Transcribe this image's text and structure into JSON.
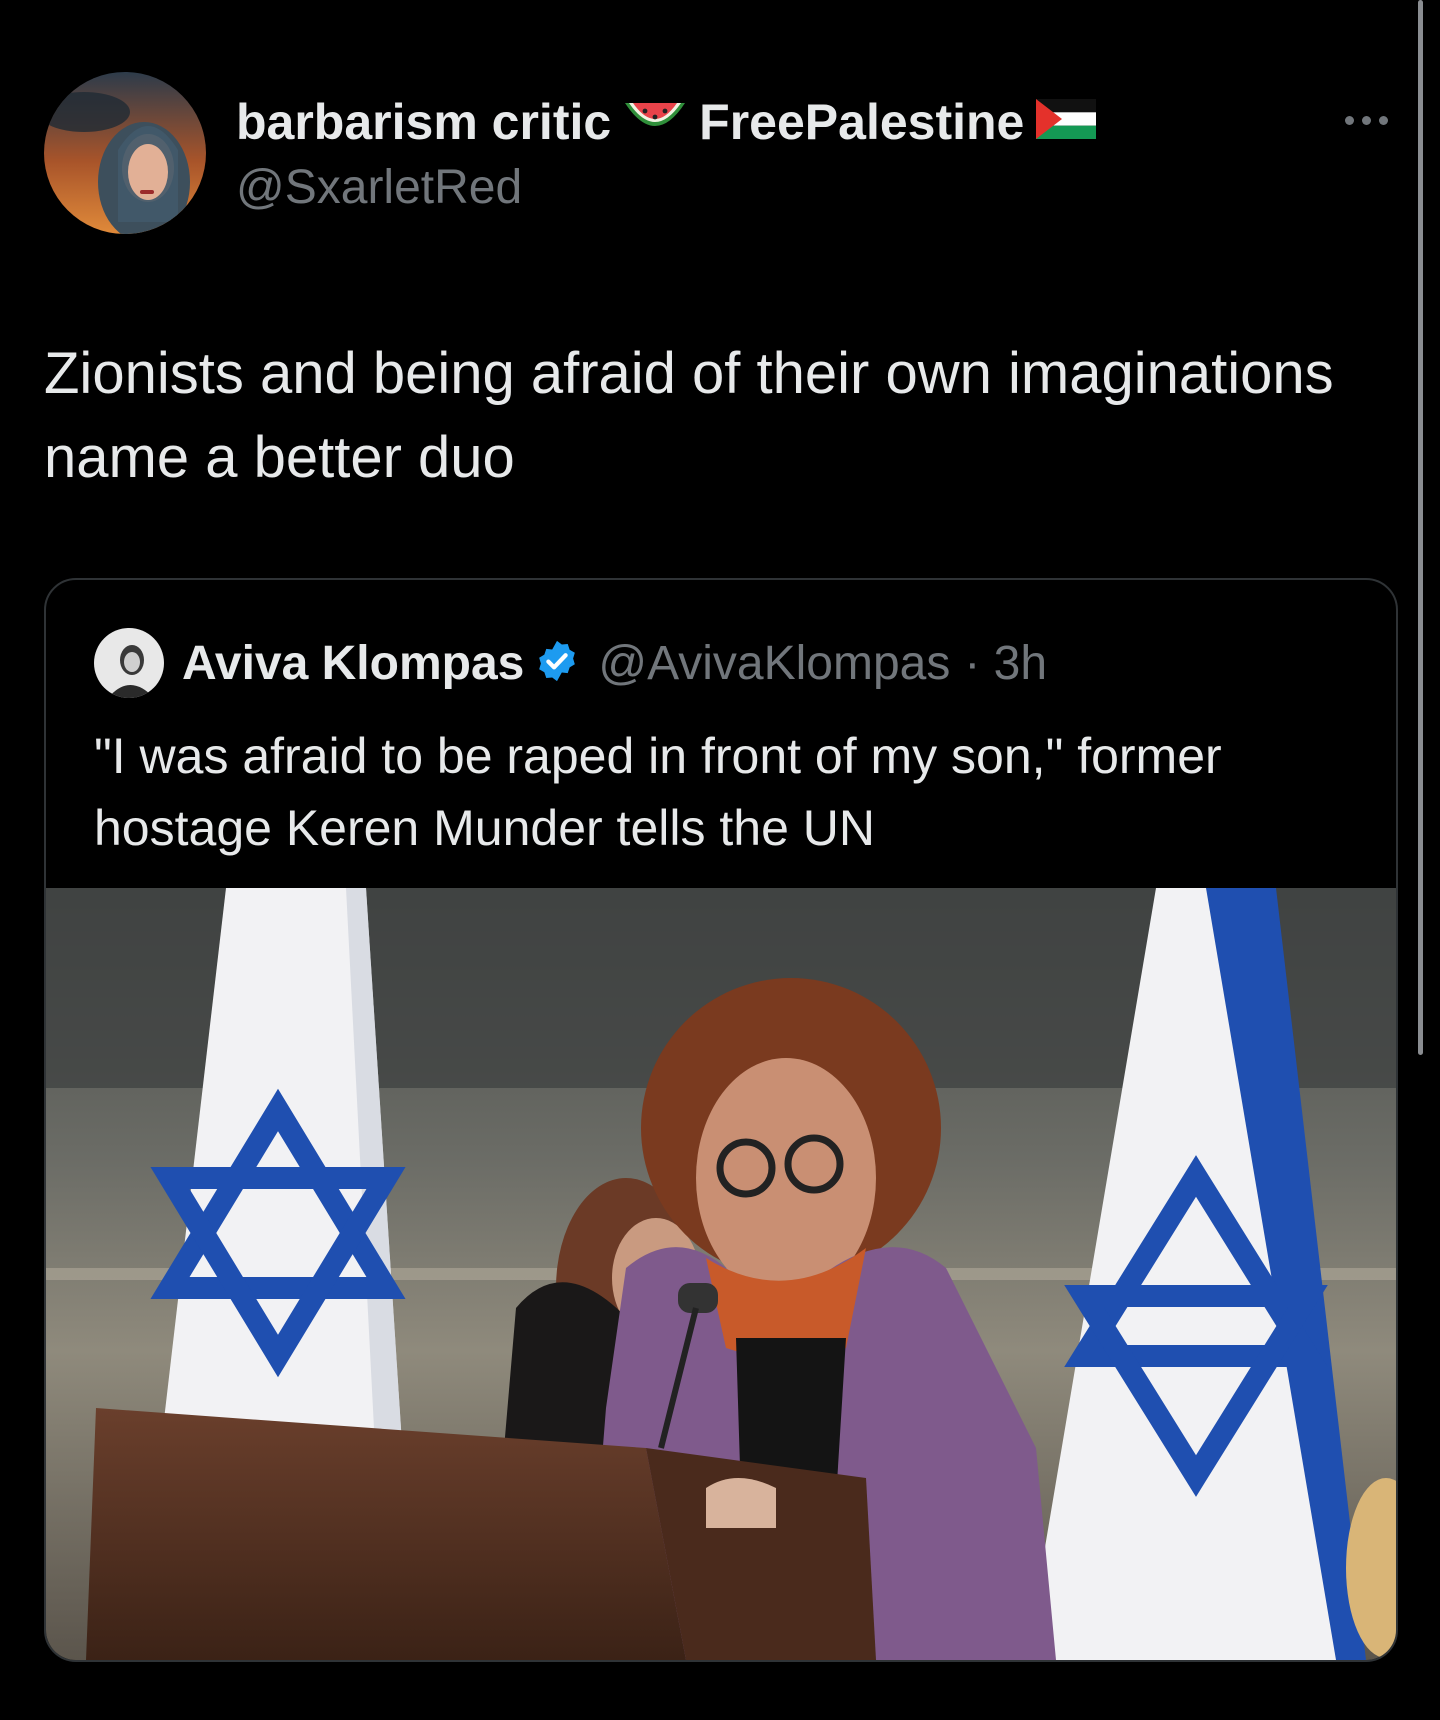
{
  "tweet": {
    "display_name": "barbarism critic",
    "display_name_suffix": "FreePalestine",
    "handle": "@SxarletRed",
    "text": "Zionists and being afraid of their own imaginations name a better duo"
  },
  "quoted": {
    "name": "Aviva Klompas",
    "handle": "@AvivaKlompas",
    "time": "· 3h",
    "text": "\"I was afraid to be raped in front of my son,\" former hostage Keren Munder tells the UN"
  },
  "icons": {
    "name_emoji_1": "watermelon-emoji",
    "name_emoji_2": "palestine-flag-emoji",
    "verified": "verified-badge-icon",
    "more": "more-options-icon"
  },
  "colors": {
    "background": "#000000",
    "primary_text": "#e7e9ea",
    "secondary_text": "#71767b",
    "verified_blue": "#1d9bf0",
    "card_border": "#2f3336"
  }
}
